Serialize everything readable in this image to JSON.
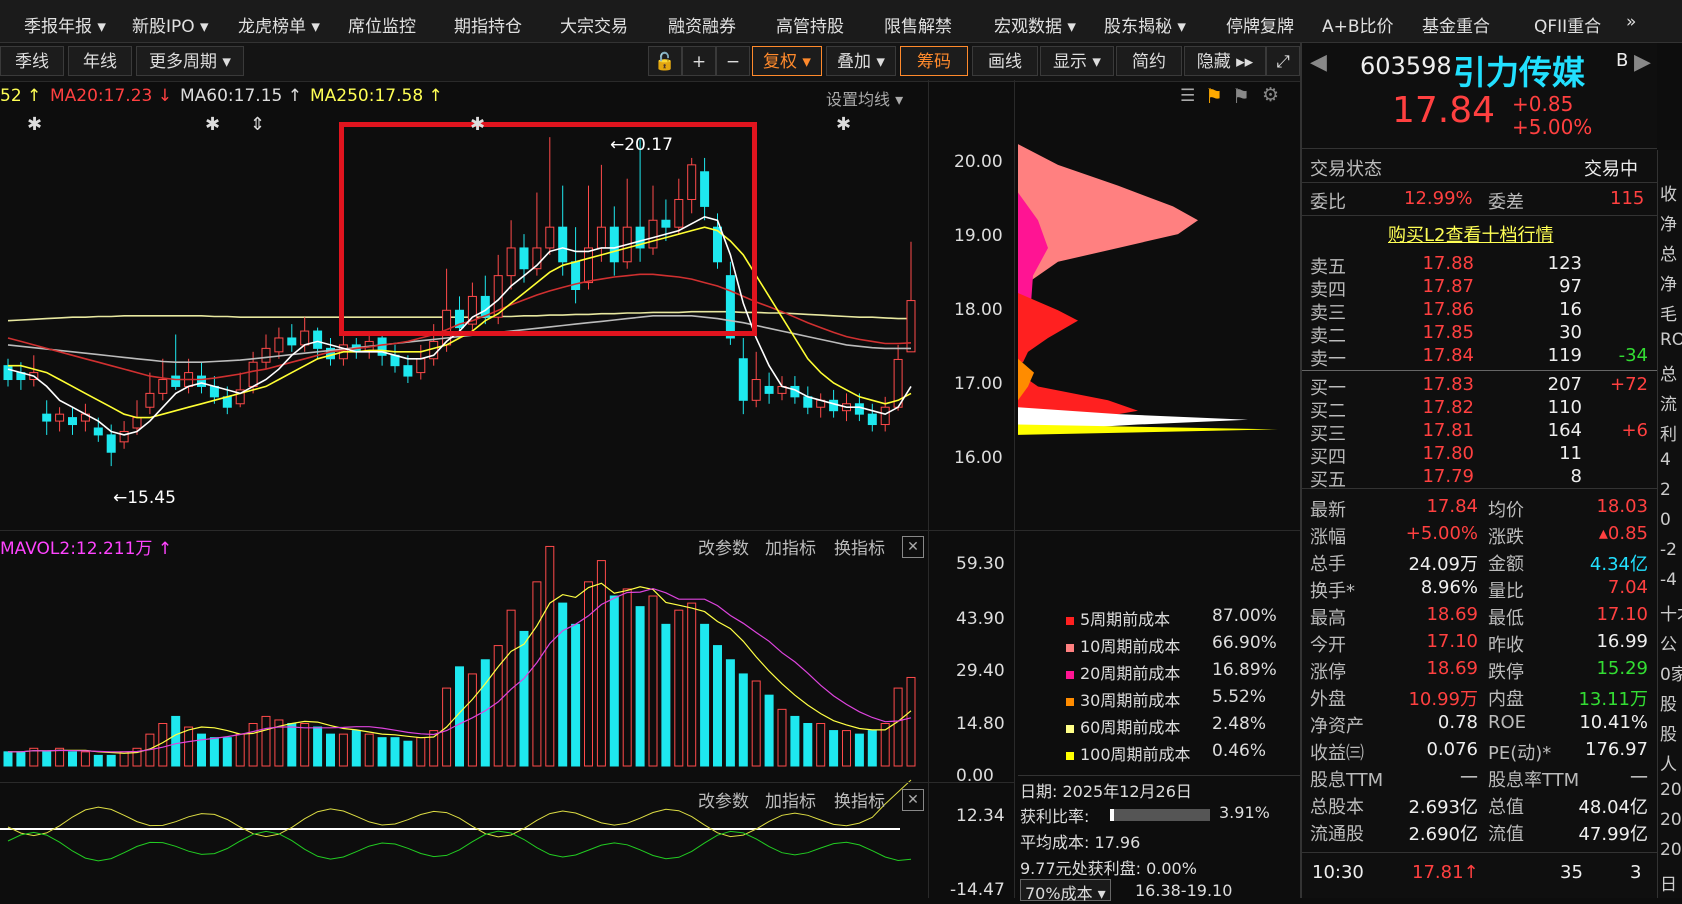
{
  "menu": [
    "季报年报 ▾",
    "新股IPO ▾",
    "龙虎榜单 ▾",
    "席位监控",
    "期指持仓",
    "大宗交易",
    "融资融券",
    "高管持股",
    "限售解禁",
    "宏观数据 ▾",
    "股东揭秘 ▾",
    "停牌复牌",
    "A+B比价",
    "基金重合",
    "QFII重合",
    "»"
  ],
  "toolbar": {
    "season": "季线",
    "year": "年线",
    "more": "更多周期 ▾",
    "lock": "🔓",
    "plus": "+",
    "minus": "−",
    "fuquan": "复权 ▾",
    "overlay": "叠加 ▾",
    "chips": "筹码",
    "draw": "画线",
    "display": "显示 ▾",
    "simple": "简约",
    "hide": "隐藏 ▸▸",
    "expand": "⤢"
  },
  "ma": {
    "ma10": "52 ↑",
    "ma20": "MA20:17.23 ↓",
    "ma60": "MA60:17.15 ↑",
    "ma250": "MA250:17.58 ↑",
    "setting": "设置均线 ▾"
  },
  "price_axis": [
    "20.00",
    "19.00",
    "18.00",
    "17.00",
    "16.00"
  ],
  "annotations": {
    "high": "←20.17",
    "low": "←15.45"
  },
  "vol": {
    "label": "MAVOL2:12.211万 ↑",
    "axis": [
      "59.30",
      "43.90",
      "29.40",
      "14.80",
      "0.00"
    ],
    "params": "改参数",
    "add": "加指标",
    "switch": "换指标"
  },
  "ind": {
    "axis_top": "12.34",
    "axis_bottom": "-14.47",
    "params": "改参数",
    "add": "加指标",
    "switch": "换指标"
  },
  "cost": {
    "rows": [
      {
        "label": "5周期前成本",
        "pct": "87.00%",
        "color": "#ff2020"
      },
      {
        "label": "10周期前成本",
        "pct": "66.90%",
        "color": "#ff8080"
      },
      {
        "label": "20周期前成本",
        "pct": "16.89%",
        "color": "#ff1493"
      },
      {
        "label": "30周期前成本",
        "pct": "5.52%",
        "color": "#ff8c00"
      },
      {
        "label": "60周期前成本",
        "pct": "2.48%",
        "color": "#ffff88"
      },
      {
        "label": "100周期前成本",
        "pct": "0.46%",
        "color": "#ffff00"
      }
    ],
    "date": "日期: 2025年12月26日",
    "profit_label": "获利比率:",
    "profit": "3.91%",
    "avg": "平均成本: 17.96",
    "profit_disk": "9.77元处获利盘: 0.00%",
    "pct_select": "70%成本 ▾",
    "range": "16.38-19.10"
  },
  "stock": {
    "code": "603598",
    "name": "引力传媒",
    "b": "B",
    "price": "17.84",
    "chg": "+0.85",
    "pct": "+5.00%"
  },
  "status": {
    "label": "交易状态",
    "value": "交易中"
  },
  "wei": {
    "ratio_label": "委比",
    "ratio": "12.99%",
    "diff_label": "委差",
    "diff": "115"
  },
  "l2": "购买L2查看十档行情",
  "asks": [
    {
      "l": "卖五",
      "p": "17.88",
      "v": "123",
      "c": ""
    },
    {
      "l": "卖四",
      "p": "17.87",
      "v": "97",
      "c": ""
    },
    {
      "l": "卖三",
      "p": "17.86",
      "v": "16",
      "c": ""
    },
    {
      "l": "卖二",
      "p": "17.85",
      "v": "30",
      "c": ""
    },
    {
      "l": "卖一",
      "p": "17.84",
      "v": "119",
      "c": "-34"
    }
  ],
  "bids": [
    {
      "l": "买一",
      "p": "17.83",
      "v": "207",
      "c": "+72"
    },
    {
      "l": "买二",
      "p": "17.82",
      "v": "110",
      "c": ""
    },
    {
      "l": "买三",
      "p": "17.81",
      "v": "164",
      "c": "+6"
    },
    {
      "l": "买四",
      "p": "17.80",
      "v": "11",
      "c": ""
    },
    {
      "l": "买五",
      "p": "17.79",
      "v": "8",
      "c": ""
    }
  ],
  "stats": [
    {
      "l1": "最新",
      "v1": "17.84",
      "c1": "red",
      "l2": "均价",
      "v2": "18.03",
      "c2": "red"
    },
    {
      "l1": "涨幅",
      "v1": "+5.00%",
      "c1": "red",
      "l2": "涨跌",
      "v2": "▴0.85",
      "c2": "red"
    },
    {
      "l1": "总手",
      "v1": "24.09万",
      "c1": "white",
      "l2": "金额",
      "v2": "4.34亿",
      "c2": "cyan"
    },
    {
      "l1": "换手*",
      "v1": "8.96%",
      "c1": "white",
      "l2": "量比",
      "v2": "7.04",
      "c2": "red"
    },
    {
      "l1": "最高",
      "v1": "18.69",
      "c1": "red",
      "l2": "最低",
      "v2": "17.10",
      "c2": "red"
    },
    {
      "l1": "今开",
      "v1": "17.10",
      "c1": "red",
      "l2": "昨收",
      "v2": "16.99",
      "c2": "white"
    },
    {
      "l1": "涨停",
      "v1": "18.69",
      "c1": "red",
      "l2": "跌停",
      "v2": "15.29",
      "c2": "green"
    },
    {
      "l1": "外盘",
      "v1": "10.99万",
      "c1": "red",
      "l2": "内盘",
      "v2": "13.11万",
      "c2": "green"
    },
    {
      "l1": "净资产",
      "v1": "0.78",
      "c1": "white",
      "l2": "ROE",
      "v2": "10.41%",
      "c2": "white"
    },
    {
      "l1": "收益㈢",
      "v1": "0.076",
      "c1": "white",
      "l2": "PE(动)*",
      "v2": "176.97",
      "c2": "white"
    },
    {
      "l1": "股息TTM",
      "v1": "—",
      "c1": "white",
      "l2": "股息率TTM",
      "v2": "—",
      "c2": "white"
    },
    {
      "l1": "总股本",
      "v1": "2.693亿",
      "c1": "white",
      "l2": "总值",
      "v2": "48.04亿",
      "c2": "white"
    },
    {
      "l1": "流通股",
      "v1": "2.690亿",
      "c1": "white",
      "l2": "流值",
      "v2": "47.99亿",
      "c2": "white"
    }
  ],
  "tick": {
    "time": "10:30",
    "price": "17.81↑",
    "vol": "35",
    "n": "3"
  },
  "side_edge": [
    "收",
    "净",
    "总",
    "净",
    "毛",
    "RO",
    "总",
    "流",
    "利",
    "4",
    "2",
    "0",
    "-2",
    "-4",
    "十才",
    "公",
    "0家",
    "股",
    "股",
    "人",
    "20",
    "20",
    "20",
    "日"
  ],
  "chart_data": {
    "type": "candlestick",
    "ylim": [
      15.0,
      20.5
    ],
    "candles": [
      [
        16.9,
        16.7,
        17.0,
        16.6
      ],
      [
        16.8,
        16.7,
        16.95,
        16.55
      ],
      [
        16.7,
        16.8,
        17.05,
        16.6
      ],
      [
        16.2,
        16.1,
        16.4,
        15.9
      ],
      [
        16.1,
        16.2,
        16.3,
        15.95
      ],
      [
        16.15,
        16.05,
        16.3,
        15.9
      ],
      [
        16.1,
        16.2,
        16.35,
        15.95
      ],
      [
        16.0,
        15.9,
        16.15,
        15.8
      ],
      [
        15.9,
        15.65,
        16.05,
        15.45
      ],
      [
        15.8,
        15.95,
        16.1,
        15.7
      ],
      [
        16.0,
        16.15,
        16.4,
        15.9
      ],
      [
        16.3,
        16.5,
        16.8,
        16.2
      ],
      [
        16.5,
        16.7,
        17.0,
        16.4
      ],
      [
        16.75,
        16.6,
        17.35,
        16.55
      ],
      [
        16.6,
        16.8,
        17.0,
        16.5
      ],
      [
        16.75,
        16.6,
        16.95,
        16.5
      ],
      [
        16.6,
        16.45,
        16.75,
        16.35
      ],
      [
        16.45,
        16.3,
        16.6,
        16.2
      ],
      [
        16.35,
        16.55,
        16.8,
        16.3
      ],
      [
        16.6,
        16.95,
        17.1,
        16.5
      ],
      [
        16.95,
        17.15,
        17.35,
        16.85
      ],
      [
        17.1,
        17.3,
        17.45,
        17.0
      ],
      [
        17.3,
        17.2,
        17.5,
        17.1
      ],
      [
        17.2,
        17.4,
        17.6,
        17.1
      ],
      [
        17.4,
        17.15,
        17.45,
        17.0
      ],
      [
        17.15,
        17.0,
        17.3,
        16.9
      ],
      [
        17.0,
        17.2,
        17.35,
        16.9
      ],
      [
        17.2,
        17.1,
        17.3,
        17.0
      ],
      [
        17.1,
        17.25,
        17.4,
        17.0
      ],
      [
        17.3,
        17.05,
        17.35,
        16.9
      ],
      [
        17.05,
        16.9,
        17.2,
        16.8
      ],
      [
        16.9,
        16.75,
        17.05,
        16.65
      ],
      [
        16.8,
        17.0,
        17.2,
        16.7
      ],
      [
        17.0,
        17.25,
        17.5,
        16.9
      ],
      [
        17.2,
        17.7,
        18.3,
        17.1
      ],
      [
        17.7,
        17.45,
        17.9,
        17.35
      ],
      [
        17.5,
        17.9,
        18.1,
        17.4
      ],
      [
        17.9,
        17.6,
        18.2,
        17.5
      ],
      [
        17.6,
        18.2,
        18.5,
        17.5
      ],
      [
        18.2,
        18.6,
        19.0,
        18.0
      ],
      [
        18.6,
        18.3,
        18.8,
        18.1
      ],
      [
        18.3,
        18.6,
        19.4,
        18.2
      ],
      [
        18.6,
        18.9,
        20.2,
        18.5
      ],
      [
        18.9,
        18.4,
        19.5,
        18.2
      ],
      [
        18.4,
        18.0,
        18.9,
        17.8
      ],
      [
        18.1,
        18.6,
        19.5,
        18.0
      ],
      [
        18.6,
        18.9,
        19.8,
        18.4
      ],
      [
        18.9,
        18.4,
        19.2,
        18.2
      ],
      [
        18.4,
        18.9,
        19.6,
        18.3
      ],
      [
        18.9,
        18.6,
        20.17,
        18.4
      ],
      [
        18.6,
        19.0,
        19.5,
        18.5
      ],
      [
        19.0,
        18.9,
        19.3,
        18.7
      ],
      [
        18.9,
        19.3,
        19.6,
        18.8
      ],
      [
        19.3,
        19.8,
        19.9,
        19.1
      ],
      [
        19.7,
        19.2,
        19.9,
        19.0
      ],
      [
        18.9,
        18.4,
        19.1,
        18.3
      ],
      [
        18.2,
        17.3,
        18.4,
        17.2
      ],
      [
        17.0,
        16.4,
        17.3,
        16.2
      ],
      [
        16.4,
        16.7,
        17.1,
        16.3
      ],
      [
        16.6,
        16.5,
        16.8,
        16.35
      ],
      [
        16.5,
        16.6,
        16.75,
        16.4
      ],
      [
        16.6,
        16.45,
        16.75,
        16.35
      ],
      [
        16.45,
        16.3,
        16.6,
        16.2
      ],
      [
        16.3,
        16.4,
        16.5,
        16.15
      ],
      [
        16.4,
        16.25,
        16.55,
        16.15
      ],
      [
        16.25,
        16.35,
        16.5,
        16.1
      ],
      [
        16.35,
        16.2,
        16.5,
        16.1
      ],
      [
        16.2,
        16.05,
        16.35,
        15.95
      ],
      [
        16.05,
        16.3,
        16.45,
        15.95
      ],
      [
        16.3,
        16.99,
        17.2,
        16.25
      ],
      [
        17.1,
        17.84,
        18.69,
        17.1
      ]
    ],
    "ma5": [
      16.85,
      16.8,
      16.75,
      16.6,
      16.4,
      16.3,
      16.2,
      16.1,
      15.95,
      15.9,
      15.95,
      16.1,
      16.3,
      16.5,
      16.6,
      16.65,
      16.6,
      16.55,
      16.5,
      16.6,
      16.7,
      16.85,
      17.05,
      17.2,
      17.25,
      17.2,
      17.15,
      17.1,
      17.1,
      17.1,
      17.05,
      17.0,
      17.0,
      17.05,
      17.25,
      17.4,
      17.6,
      17.7,
      17.85,
      18.05,
      18.2,
      18.35,
      18.55,
      18.6,
      18.55,
      18.55,
      18.6,
      18.6,
      18.65,
      18.7,
      18.75,
      18.8,
      18.85,
      18.95,
      19.05,
      19.0,
      18.5,
      17.8,
      17.3,
      16.9,
      16.6,
      16.55,
      16.45,
      16.4,
      16.35,
      16.3,
      16.3,
      16.25,
      16.2,
      16.3,
      16.6
    ],
    "ma10": [
      16.9,
      16.9,
      16.85,
      16.8,
      16.7,
      16.6,
      16.5,
      16.4,
      16.3,
      16.2,
      16.15,
      16.15,
      16.2,
      16.25,
      16.3,
      16.35,
      16.4,
      16.45,
      16.5,
      16.55,
      16.6,
      16.7,
      16.8,
      16.9,
      17.0,
      17.05,
      17.1,
      17.1,
      17.12,
      17.12,
      17.1,
      17.1,
      17.1,
      17.15,
      17.2,
      17.3,
      17.4,
      17.55,
      17.65,
      17.8,
      17.95,
      18.1,
      18.25,
      18.35,
      18.4,
      18.45,
      18.5,
      18.55,
      18.6,
      18.65,
      18.7,
      18.75,
      18.8,
      18.85,
      18.9,
      18.85,
      18.7,
      18.5,
      18.2,
      17.9,
      17.6,
      17.3,
      17.0,
      16.8,
      16.65,
      16.55,
      16.45,
      16.4,
      16.35,
      16.4,
      16.5
    ],
    "ma20": [
      17.3,
      17.25,
      17.2,
      17.15,
      17.1,
      17.05,
      17.0,
      16.95,
      16.9,
      16.85,
      16.8,
      16.75,
      16.72,
      16.7,
      16.7,
      16.7,
      16.72,
      16.75,
      16.78,
      16.82,
      16.85,
      16.9,
      16.95,
      17.0,
      17.05,
      17.1,
      17.12,
      17.15,
      17.17,
      17.2,
      17.22,
      17.25,
      17.3,
      17.35,
      17.42,
      17.5,
      17.55,
      17.62,
      17.7,
      17.78,
      17.85,
      17.92,
      17.98,
      18.03,
      18.08,
      18.12,
      18.15,
      18.18,
      18.2,
      18.22,
      18.22,
      18.2,
      18.18,
      18.15,
      18.1,
      18.05,
      17.98,
      17.9,
      17.82,
      17.75,
      17.68,
      17.6,
      17.52,
      17.45,
      17.38,
      17.32,
      17.28,
      17.25,
      17.22,
      17.22,
      17.23
    ],
    "ma60": [
      17.2,
      17.18,
      17.16,
      17.14,
      17.12,
      17.1,
      17.08,
      17.06,
      17.04,
      17.02,
      17.0,
      16.98,
      16.96,
      16.95,
      16.95,
      16.95,
      16.96,
      16.97,
      16.98,
      17.0,
      17.02,
      17.04,
      17.06,
      17.08,
      17.1,
      17.12,
      17.14,
      17.16,
      17.18,
      17.2,
      17.22,
      17.24,
      17.26,
      17.28,
      17.3,
      17.32,
      17.34,
      17.36,
      17.38,
      17.4,
      17.42,
      17.44,
      17.46,
      17.48,
      17.5,
      17.52,
      17.54,
      17.56,
      17.58,
      17.6,
      17.62,
      17.62,
      17.62,
      17.62,
      17.6,
      17.58,
      17.55,
      17.52,
      17.48,
      17.44,
      17.4,
      17.36,
      17.32,
      17.28,
      17.24,
      17.2,
      17.18,
      17.16,
      17.15,
      17.15,
      17.15
    ],
    "ma250": [
      17.55,
      17.56,
      17.57,
      17.58,
      17.59,
      17.6,
      17.6,
      17.61,
      17.61,
      17.62,
      17.62,
      17.62,
      17.62,
      17.62,
      17.62,
      17.62,
      17.61,
      17.61,
      17.6,
      17.6,
      17.6,
      17.6,
      17.6,
      17.6,
      17.6,
      17.6,
      17.6,
      17.6,
      17.6,
      17.6,
      17.6,
      17.6,
      17.6,
      17.6,
      17.6,
      17.6,
      17.6,
      17.6,
      17.61,
      17.61,
      17.62,
      17.62,
      17.63,
      17.63,
      17.64,
      17.64,
      17.65,
      17.65,
      17.66,
      17.66,
      17.67,
      17.67,
      17.67,
      17.68,
      17.68,
      17.68,
      17.68,
      17.67,
      17.67,
      17.66,
      17.66,
      17.65,
      17.64,
      17.63,
      17.62,
      17.61,
      17.6,
      17.6,
      17.59,
      17.58,
      17.58
    ],
    "vol": [
      4,
      4,
      5,
      4,
      5,
      4,
      4,
      3,
      3,
      4,
      5,
      9,
      12,
      14,
      11,
      9,
      8,
      8,
      9,
      12,
      14,
      13,
      12,
      12,
      11,
      9,
      9,
      10,
      9,
      8,
      8,
      7,
      8,
      10,
      22,
      28,
      26,
      30,
      34,
      44,
      38,
      52,
      62,
      46,
      40,
      52,
      58,
      48,
      50,
      45,
      48,
      40,
      44,
      46,
      40,
      34,
      30,
      26,
      24,
      20,
      16,
      14,
      12,
      12,
      10,
      10,
      9,
      10,
      12,
      22,
      25
    ]
  }
}
